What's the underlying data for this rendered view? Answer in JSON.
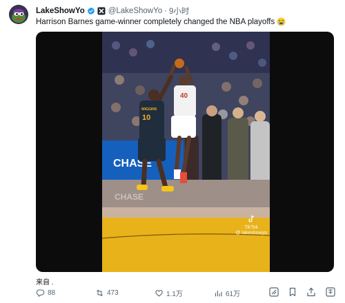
{
  "tweet": {
    "display_name": "LakeShowYo",
    "handle": "@LakeShowYo",
    "separator": "·",
    "time": "9小时",
    "text": "Harrison Barnes game-winner completely changed the NBA playoffs",
    "emoji_icon": "loudly-crying-face-icon",
    "source_label": "来自 ."
  },
  "media": {
    "jersey_white_number": "40",
    "jersey_dark_name": "WIGGINS",
    "jersey_dark_number": "10",
    "courtside_banner": "CHASE",
    "floor_reflection": "CHASE",
    "watermark_brand": "TikTok",
    "watermark_handle": "@ lakeshowyo"
  },
  "actions": {
    "replies": "88",
    "reposts": "473",
    "likes": "1.1万",
    "views": "61万"
  },
  "colors": {
    "verified_blue": "#1d9bf0",
    "meta_gray": "#536471",
    "court_yellow": "#e8b21b",
    "chase_blue": "#1560bd"
  }
}
